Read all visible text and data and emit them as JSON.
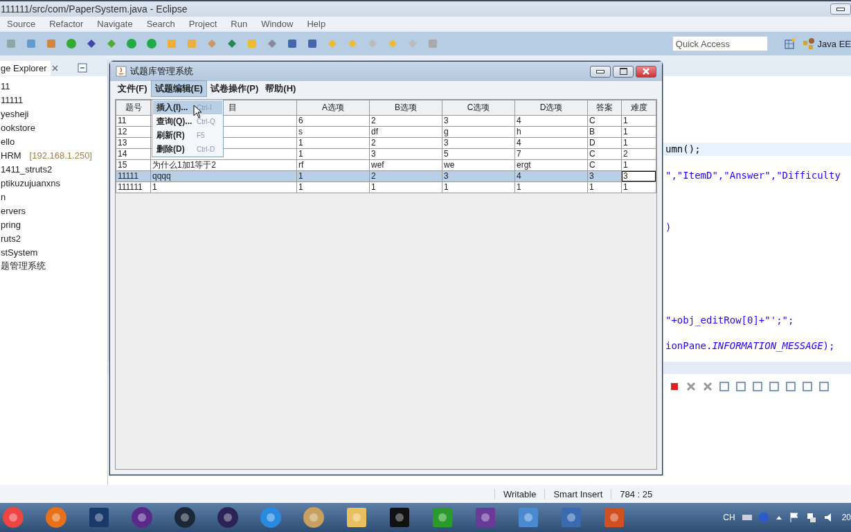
{
  "window": {
    "title": "111111/src/com/PaperSystem.java - Eclipse"
  },
  "menu": [
    "Source",
    "Refactor",
    "Navigate",
    "Search",
    "Project",
    "Run",
    "Window",
    "Help"
  ],
  "quick_access": {
    "placeholder": "Quick Access"
  },
  "perspective": {
    "label": "Java EE"
  },
  "explorer": {
    "title": "ge Explorer",
    "items": [
      {
        "label": "11"
      },
      {
        "label": "11111"
      },
      {
        "label": "yesheji"
      },
      {
        "label": "ookstore"
      },
      {
        "label": "ello"
      },
      {
        "label": "HRM",
        "decoration": "[192.168.1.250]"
      },
      {
        "label": "1411_struts2"
      },
      {
        "label": "ptikuzujuanxns"
      },
      {
        "label": "n"
      },
      {
        "label": "ervers"
      },
      {
        "label": "pring"
      },
      {
        "label": "ruts2"
      },
      {
        "label": "stSystem"
      },
      {
        "label": "题管理系统"
      }
    ]
  },
  "editor": {
    "lines": [
      {
        "text": "umn();",
        "current": true
      },
      {
        "text": "\",\"ItemD\",\"Answer\",\"Difficulty",
        "current": false
      },
      {
        "text": ")",
        "current": false
      },
      {
        "text": "\"+obj_editRow[0]+\"';\";",
        "current": false
      },
      {
        "text": "ionPane.*INFORMATION_MESSAGE*);",
        "current": false
      }
    ]
  },
  "status_bar": [
    "Writable",
    "Smart Insert",
    "784 : 25"
  ],
  "tray": {
    "language": "CH",
    "clock": "20"
  },
  "dialog": {
    "title": "试题库管理系统",
    "menu": [
      {
        "label": "文件(F)",
        "selected": false
      },
      {
        "label": "试题编辑(E)",
        "selected": true
      },
      {
        "label": "试卷操作(P)",
        "selected": false
      },
      {
        "label": "帮助(H)",
        "selected": false
      }
    ],
    "popup": [
      {
        "label": "插入(I)...",
        "shortcut": "Ctrl-I",
        "selected": true
      },
      {
        "label": "查询(Q)...",
        "shortcut": "Ctrl-Q",
        "selected": false
      },
      {
        "label": "刷新(R)",
        "shortcut": "F5",
        "selected": false
      },
      {
        "label": "删除(D)",
        "shortcut": "Ctrl-D",
        "selected": false
      }
    ],
    "table": {
      "columns": [
        "题号",
        "目",
        "A选项",
        "B选项",
        "C选项",
        "D选项",
        "答案",
        "难度"
      ],
      "rows": [
        {
          "id": "11",
          "options": [
            "6",
            "2",
            "3",
            "4"
          ],
          "answer": "C",
          "difficulty": "1",
          "selected": false,
          "focused": false
        },
        {
          "id": "12",
          "options": [
            "s",
            "df",
            "g",
            "h"
          ],
          "answer": "B",
          "difficulty": "1",
          "selected": false,
          "focused": false
        },
        {
          "id": "13",
          "options": [
            "1",
            "2",
            "3",
            "4"
          ],
          "answer": "D",
          "difficulty": "1",
          "selected": false,
          "focused": false
        },
        {
          "id": "14",
          "options": [
            "1",
            "3",
            "5",
            "7"
          ],
          "answer": "C",
          "difficulty": "2",
          "selected": false,
          "focused": false
        },
        {
          "id": "15",
          "question": "为什么1加1等于2",
          "options": [
            "rf",
            "wef",
            "we",
            "ergt"
          ],
          "answer": "C",
          "difficulty": "1",
          "selected": false,
          "focused": false
        },
        {
          "id": "11111",
          "question": "qqqq",
          "options": [
            "1",
            "2",
            "3",
            "4"
          ],
          "answer": "3",
          "difficulty": "3",
          "selected": true,
          "focused": true
        },
        {
          "id": "111111",
          "question": "1",
          "options": [
            "1",
            "1",
            "1",
            "1"
          ],
          "answer": "1",
          "difficulty": "1",
          "selected": false,
          "focused": false
        }
      ]
    }
  }
}
